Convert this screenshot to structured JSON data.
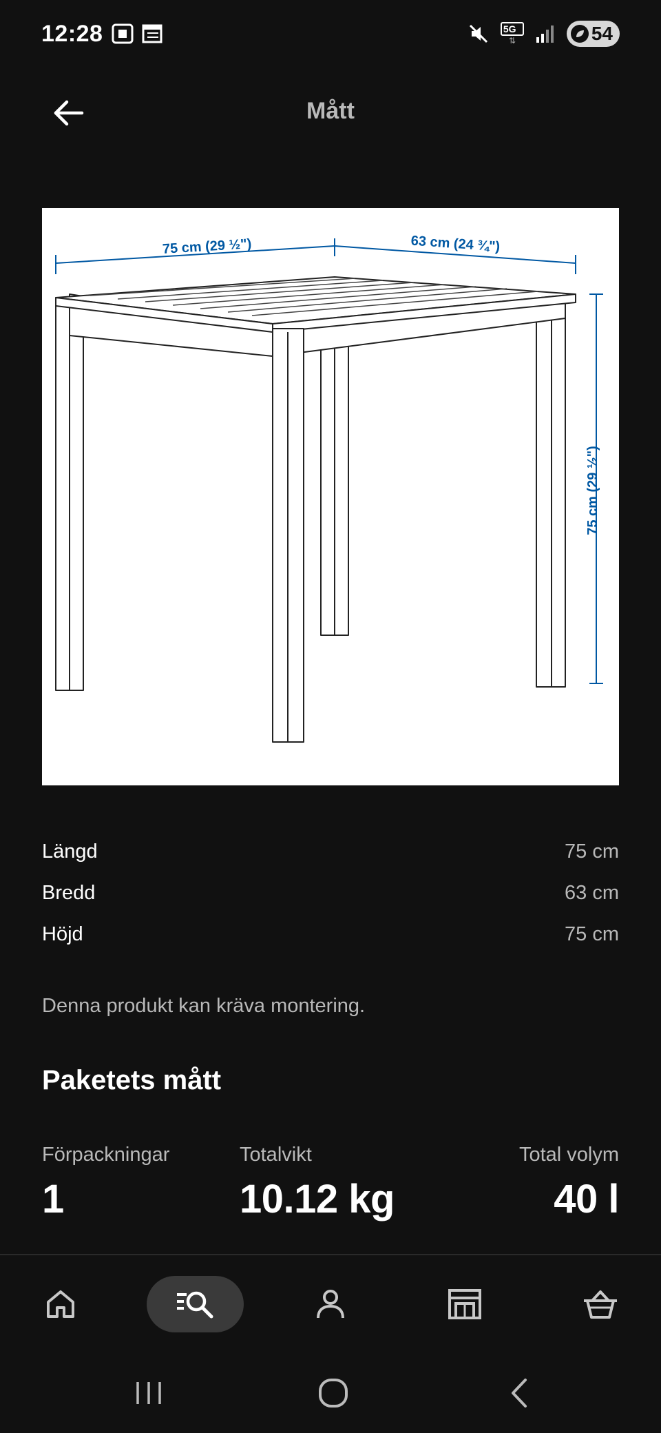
{
  "status_bar": {
    "time": "12:28",
    "network": "5G",
    "battery": "54"
  },
  "header": {
    "title": "Mått",
    "back_icon": "arrow-left-icon"
  },
  "product_image": {
    "width_label": "75 cm (29 ½\")",
    "depth_label": "63 cm (24 ¾\")",
    "height_label": "75 cm (29 ½\")",
    "dimension_color": "#0058a3"
  },
  "dimensions": [
    {
      "label": "Längd",
      "value": "75 cm"
    },
    {
      "label": "Bredd",
      "value": "63 cm"
    },
    {
      "label": "Höjd",
      "value": "75 cm"
    }
  ],
  "assembly_note": "Denna produkt kan kräva montering.",
  "package": {
    "heading": "Paketets mått",
    "stats": [
      {
        "label": "Förpackningar",
        "value": "1"
      },
      {
        "label": "Totalvikt",
        "value": "10.12 kg"
      },
      {
        "label": "Total volym",
        "value": "40 l"
      }
    ]
  },
  "bottom_nav": [
    {
      "name": "home",
      "icon": "home-icon"
    },
    {
      "name": "search",
      "icon": "search-icon",
      "active": true
    },
    {
      "name": "profile",
      "icon": "person-icon"
    },
    {
      "name": "store",
      "icon": "store-icon"
    },
    {
      "name": "cart",
      "icon": "basket-icon"
    }
  ],
  "system_nav": [
    "recent-apps-icon",
    "home-circle-icon",
    "back-chevron-icon"
  ]
}
